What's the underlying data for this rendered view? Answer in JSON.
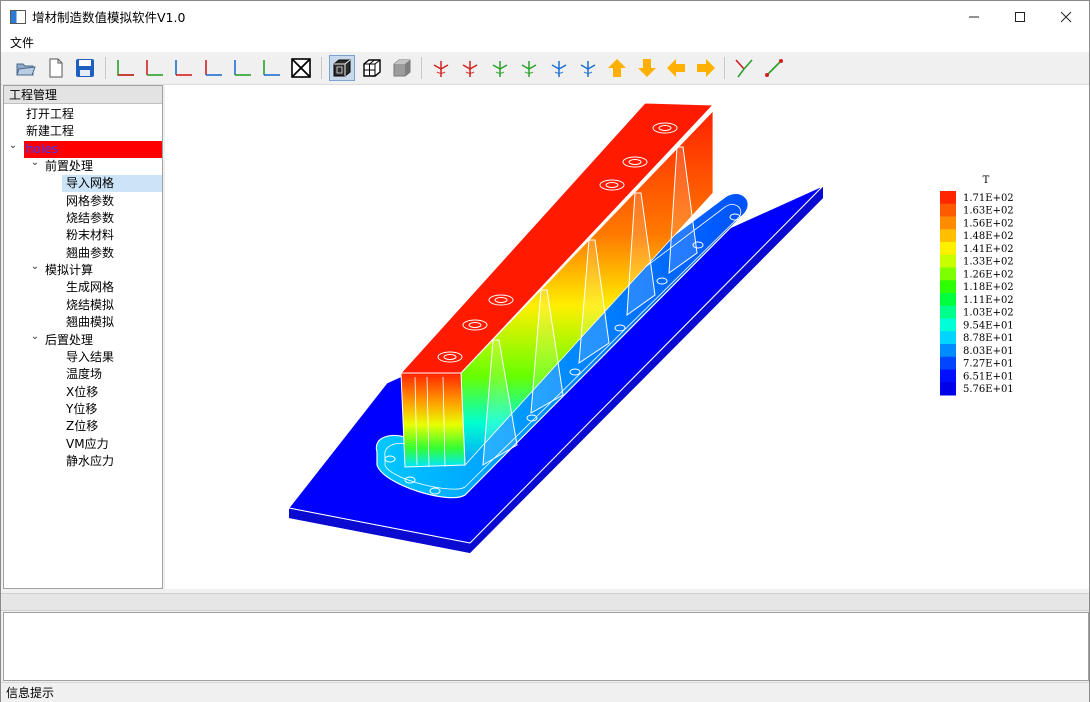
{
  "window": {
    "title": "增材制造数值模拟软件V1.0"
  },
  "menu": {
    "items": [
      "文件"
    ]
  },
  "toolbar": {
    "accent_colors": {
      "x_axis": "#d32020",
      "y_axis": "#2aa02a",
      "z_axis": "#1e6fd0",
      "arrow": "#ffb000"
    }
  },
  "panel": {
    "title": "工程管理"
  },
  "tree": {
    "items": [
      "打开工程",
      "新建工程",
      "holes",
      "前置处理",
      "导入网格",
      "网格参数",
      "烧结参数",
      "粉末材料",
      "翘曲参数",
      "模拟计算",
      "生成网格",
      "烧结模拟",
      "翘曲模拟",
      "后置处理",
      "导入结果",
      "温度场",
      "X位移",
      "Y位移",
      "Z位移",
      "VM应力",
      "静水应力"
    ],
    "selected_project": "holes",
    "highlighted_item": "导入网格"
  },
  "legend": {
    "title": "T",
    "labels": [
      "1.71E+02",
      "1.63E+02",
      "1.56E+02",
      "1.48E+02",
      "1.41E+02",
      "1.33E+02",
      "1.26E+02",
      "1.18E+02",
      "1.11E+02",
      "1.03E+02",
      "9.54E+01",
      "8.78E+01",
      "8.03E+01",
      "7.27E+01",
      "6.51E+01",
      "5.76E+01"
    ],
    "colors": [
      "#ff2600",
      "#ff5a00",
      "#ff8c00",
      "#ffbf00",
      "#fff000",
      "#c8ff00",
      "#7dff00",
      "#2eff00",
      "#00ff3c",
      "#00ff8a",
      "#00ffd8",
      "#00d4ff",
      "#008cff",
      "#0046ff",
      "#0010ff",
      "#0000e8"
    ]
  },
  "status": {
    "text": "信息提示"
  }
}
